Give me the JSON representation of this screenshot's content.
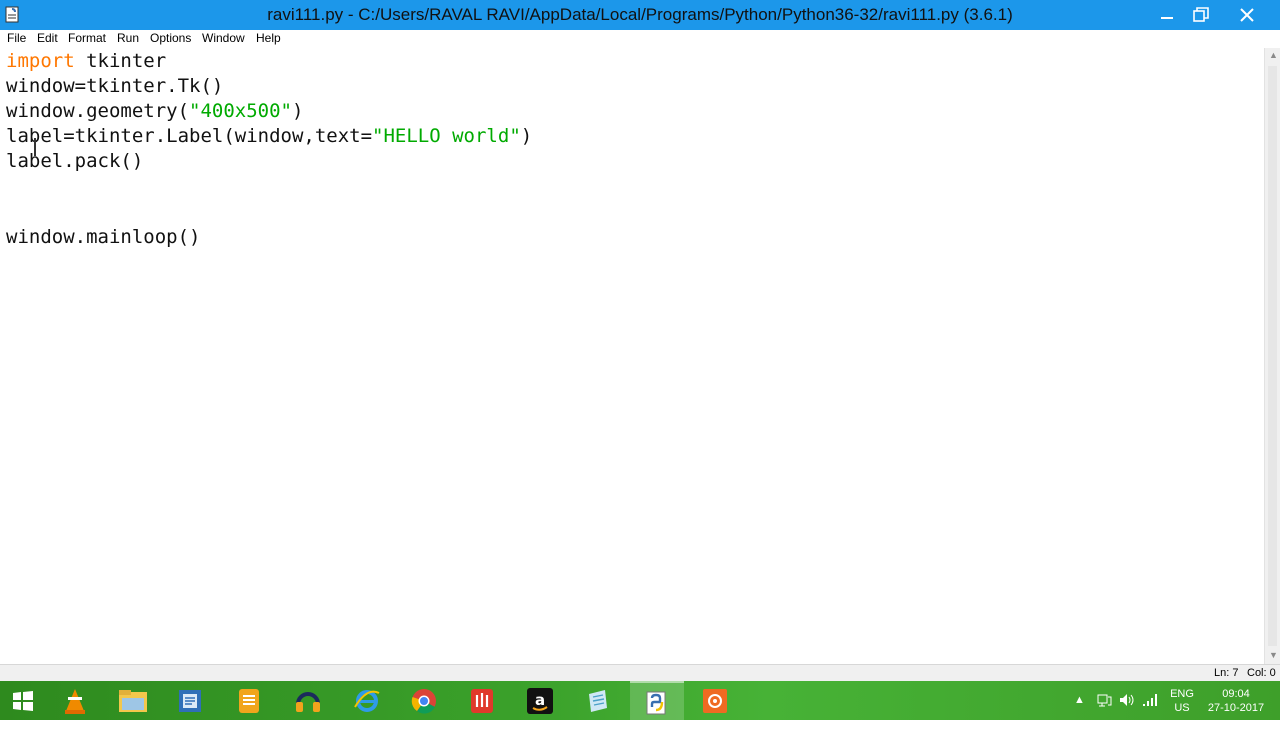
{
  "window": {
    "title": "ravi111.py - C:/Users/RAVAL RAVI/AppData/Local/Programs/Python/Python36-32/ravi111.py (3.6.1)",
    "minimize_symbol": "—",
    "maximize_symbol": "❐",
    "close_symbol": "✕",
    "icon": "python-file-icon"
  },
  "menu": {
    "items": [
      "File",
      "Edit",
      "Format",
      "Run",
      "Options",
      "Window",
      "Help"
    ]
  },
  "code": {
    "lines": [
      {
        "parts": [
          {
            "t": "import",
            "c": "kw"
          },
          {
            "t": " tkinter",
            "c": ""
          }
        ]
      },
      {
        "parts": [
          {
            "t": "window=tkinter.Tk()",
            "c": ""
          }
        ]
      },
      {
        "parts": [
          {
            "t": "window.geometry(",
            "c": ""
          },
          {
            "t": "\"400x500\"",
            "c": "str"
          },
          {
            "t": ")",
            "c": ""
          }
        ]
      },
      {
        "parts": [
          {
            "t": "label=tkinter.Label(window,text=",
            "c": ""
          },
          {
            "t": "\"HELLO world\"",
            "c": "str"
          },
          {
            "t": ")",
            "c": ""
          }
        ]
      },
      {
        "parts": [
          {
            "t": "label.pack()",
            "c": ""
          }
        ]
      },
      {
        "parts": []
      },
      {
        "parts": []
      },
      {
        "parts": [
          {
            "t": "window.mainloop()",
            "c": ""
          }
        ]
      }
    ],
    "colors": {
      "keyword": "#ff7700",
      "string": "#00aa00",
      "default": "#111111"
    }
  },
  "status": {
    "line": "Ln: 7",
    "column": "Col: 0"
  },
  "taskbar": {
    "apps": [
      {
        "name": "start-button-icon"
      },
      {
        "name": "vlc-icon"
      },
      {
        "name": "file-explorer-icon"
      },
      {
        "name": "word-icon"
      },
      {
        "name": "notes-icon"
      },
      {
        "name": "audio-player-icon"
      },
      {
        "name": "internet-explorer-icon"
      },
      {
        "name": "chrome-icon"
      },
      {
        "name": "red-app-icon"
      },
      {
        "name": "amazon-icon"
      },
      {
        "name": "notepad-icon"
      },
      {
        "name": "python-idle-icon",
        "active": true
      },
      {
        "name": "orange-app-icon"
      }
    ],
    "tray": {
      "language": "ENG",
      "region": "US",
      "time": "09:04",
      "date": "27-10-2017"
    }
  }
}
